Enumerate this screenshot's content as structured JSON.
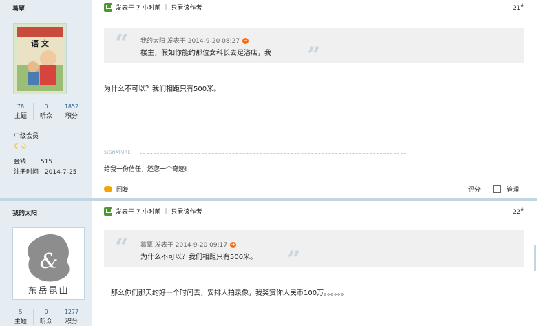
{
  "posts": [
    {
      "author": "葛覃",
      "stats": [
        {
          "num": "78",
          "label": "主题"
        },
        {
          "num": "0",
          "label": "听众"
        },
        {
          "num": "1852",
          "label": "积分"
        }
      ],
      "rank": "中级会员",
      "money_label": "金钱",
      "money_value": "515",
      "reg_label": "注册时间",
      "reg_value": "2014-7-25",
      "header_time": "发表于 7 小时前",
      "header_only": "只看该作者",
      "floor_num": "21",
      "floor_sup": "#",
      "quote_meta": "我的太阳 发表于 2014-9-20 08:27",
      "quote_text": "楼主，假如你能约那位女科长去足浴店，我",
      "body": "为什么不可以？我们相距只有500米。",
      "signature_label": "SIGNATURE",
      "signature_text": "给我一份信任，还您一个奇迹!",
      "reply": "回复",
      "rate": "评分",
      "manage": "管理",
      "avatar_text_top": "语 文"
    },
    {
      "author": "我的太阳",
      "stats": [
        {
          "num": "5",
          "label": "主题"
        },
        {
          "num": "0",
          "label": "听众"
        },
        {
          "num": "1277",
          "label": "积分"
        }
      ],
      "header_time": "发表于 7 小时前",
      "header_only": "只看该作者",
      "floor_num": "22",
      "floor_sup": "#",
      "quote_meta": "葛覃 发表于 2014-9-20 09:17",
      "quote_text": "为什么不可以？我们相距只有500米。",
      "body": "那么你们那天约好一个时间去，安排人拍录像，我奖赏你人民币100万。。。。。。",
      "avatar_caption": "东岳昆山"
    }
  ],
  "colors": {
    "sidebar": "#e5edf2",
    "border": "#c2d5e3",
    "link": "#336699",
    "accent": "#ff6600"
  }
}
